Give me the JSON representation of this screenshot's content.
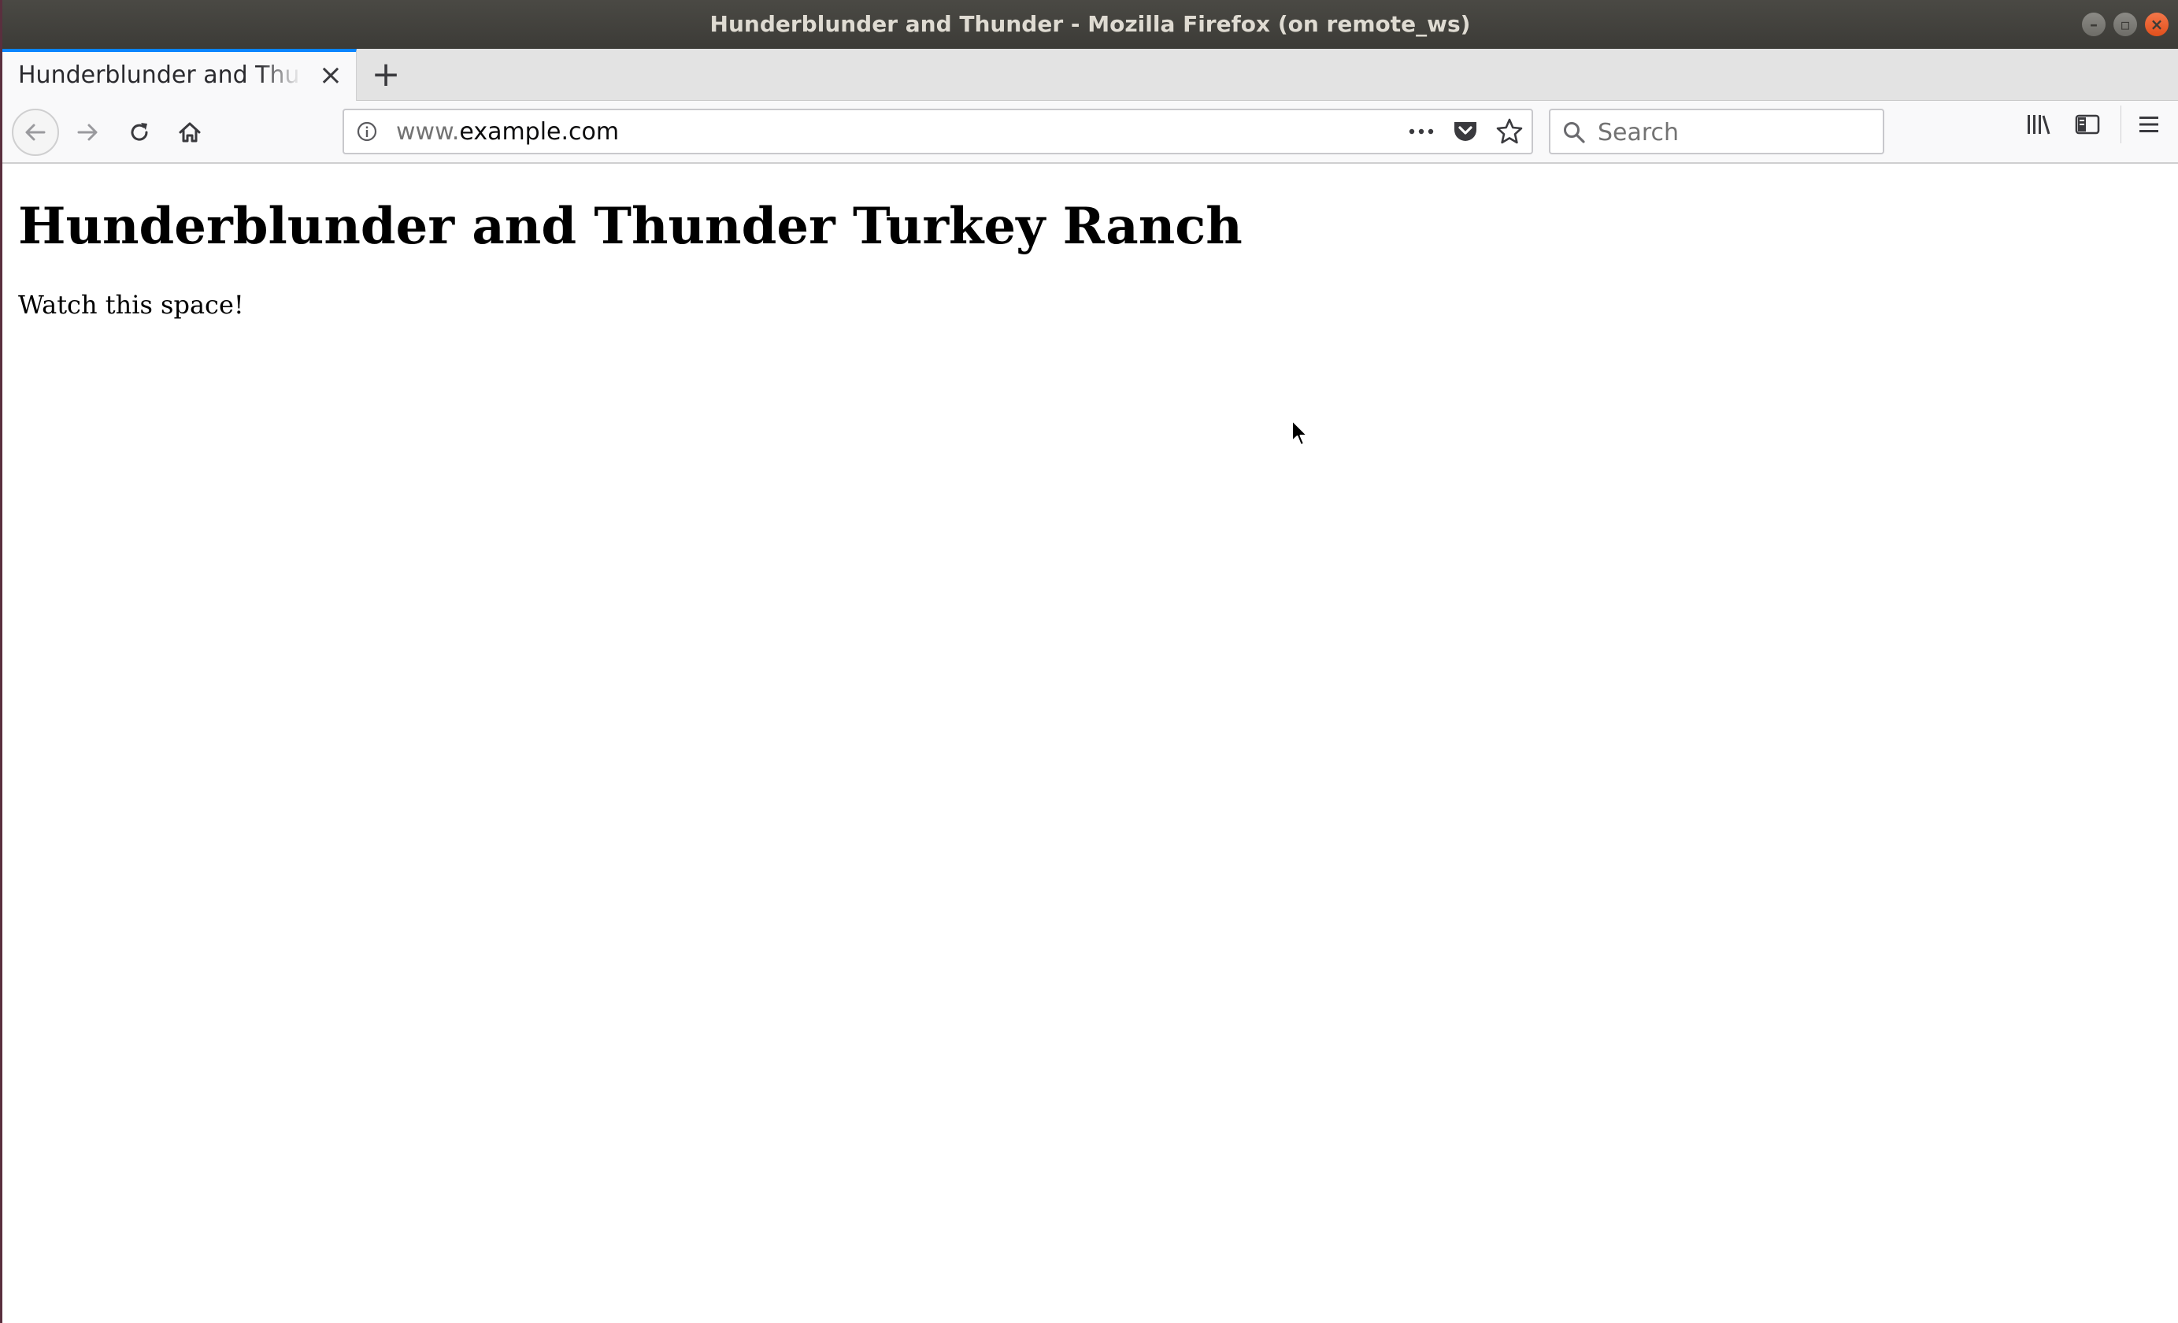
{
  "window": {
    "title": "Hunderblunder and Thunder - Mozilla Firefox (on remote_ws)",
    "controls": [
      "minimize",
      "maximize",
      "close"
    ]
  },
  "tabs": [
    {
      "label": "Hunderblunder and Thunder",
      "active": true
    }
  ],
  "toolbar": {
    "url_prefix": "www.",
    "url_host": "example.com",
    "search_placeholder": "Search",
    "accent_color": "#0a84ff"
  },
  "icons": {
    "back": "back-arrow-icon",
    "forward": "forward-arrow-icon",
    "reload": "reload-icon",
    "home": "home-icon",
    "info": "info-icon",
    "page_actions": "more-icon",
    "pocket": "pocket-icon",
    "bookmark": "star-icon",
    "library": "library-icon",
    "sidebar": "sidebar-icon",
    "menu": "hamburger-menu-icon"
  },
  "page": {
    "heading": "Hunderblunder and Thunder Turkey Ranch",
    "body": "Watch this space!"
  }
}
